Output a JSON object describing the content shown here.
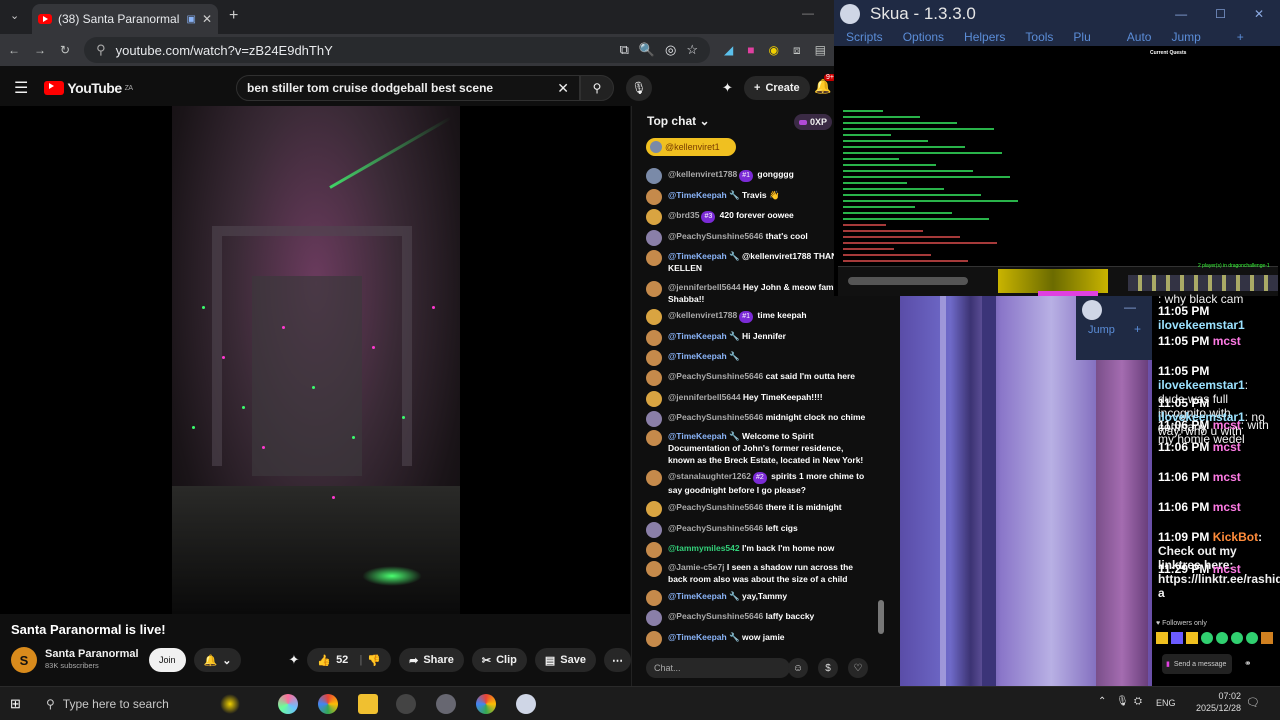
{
  "browser": {
    "tab_title": "(38) Santa Paranormal is live!",
    "url": "youtube.com/watch?v=zB24E9dhThY"
  },
  "youtube": {
    "logo": "YouTube",
    "region": "ZA",
    "search_value": "ben stiller tom cruise dodgeball best scene",
    "create_label": "Create",
    "notif_count": "9+"
  },
  "video": {
    "title": "Santa Paranormal is live!",
    "channel": "Santa Paranormal",
    "subscribers": "83K subscribers",
    "join_label": "Join",
    "likes": "52",
    "share_label": "Share",
    "clip_label": "Clip",
    "save_label": "Save"
  },
  "chat": {
    "header": "Top chat",
    "xp_label": "0XP",
    "pinned_user": "@kellenviret1",
    "messages": [
      {
        "user": "@kellenviret1788",
        "badge": "#1",
        "text": "gongggg",
        "role": "normal"
      },
      {
        "user": "@TimeKeepah",
        "badge": "",
        "text": "Travis 👋",
        "role": "mod"
      },
      {
        "user": "@brd35",
        "badge": "#3",
        "text": "420 forever oowee",
        "role": "normal"
      },
      {
        "user": "@PeachySunshine5646",
        "badge": "",
        "text": "that's cool",
        "role": "normal"
      },
      {
        "user": "@TimeKeepah",
        "badge": "",
        "text": "@kellenviret1788 THANK YOU KELLEN",
        "role": "mod"
      },
      {
        "user": "@jenniferbell5644",
        "badge": "",
        "text": "Hey John & meow fam! doing Shabba!!",
        "role": "normal"
      },
      {
        "user": "@kellenviret1788",
        "badge": "#1",
        "text": "time keepah",
        "role": "normal"
      },
      {
        "user": "@TimeKeepah",
        "badge": "",
        "text": "Hi Jennifer",
        "role": "mod"
      },
      {
        "user": "@TimeKeepah",
        "badge": "",
        "text": "",
        "role": "mod"
      },
      {
        "user": "@PeachySunshine5646",
        "badge": "",
        "text": "cat said I'm outta here",
        "role": "normal"
      },
      {
        "user": "@jenniferbell5644",
        "badge": "",
        "text": "Hey TimeKeepah!!!!",
        "role": "normal"
      },
      {
        "user": "@PeachySunshine5646",
        "badge": "",
        "text": "midnight clock no chime",
        "role": "normal"
      },
      {
        "user": "@TimeKeepah",
        "badge": "",
        "text": "Welcome to Spirit Documentation of John's former residence, known as the Breck Estate, located in New York!",
        "role": "mod"
      },
      {
        "user": "@stanalaughter1262",
        "badge": "#2",
        "text": "spirits 1 more chime to say goodnight before I go please?",
        "role": "normal"
      },
      {
        "user": "@PeachySunshine5646",
        "badge": "",
        "text": "there it is midnight",
        "role": "normal"
      },
      {
        "user": "@PeachySunshine5646",
        "badge": "",
        "text": "left cigs",
        "role": "normal"
      },
      {
        "user": "@tammymiles542",
        "badge": "",
        "text": "I'm back I'm home now",
        "role": "green"
      },
      {
        "user": "@Jamie-c5e7j",
        "badge": "",
        "text": "I seen a shadow run across the back room also was about the size of a child",
        "role": "normal"
      },
      {
        "user": "@TimeKeepah",
        "badge": "",
        "text": "yay,Tammy",
        "role": "mod"
      },
      {
        "user": "@PeachySunshine5646",
        "badge": "",
        "text": "laffy baccky",
        "role": "normal"
      },
      {
        "user": "@TimeKeepah",
        "badge": "",
        "text": "wow jamie",
        "role": "mod"
      }
    ],
    "input_placeholder": "Chat..."
  },
  "skua": {
    "title": "Skua - 1.3.3.0",
    "menu": [
      "Scripts",
      "Options",
      "Helpers",
      "Tools",
      "Plu",
      "Auto",
      "Jump"
    ],
    "quest_title": "Current Quests",
    "players": "2 player(s) in dragonchallenge-1"
  },
  "twitch": {
    "messages": [
      {
        "time": "",
        "user": "",
        "text": ": why black cam"
      },
      {
        "time": "11:05 PM",
        "user": "ilovekeemstar1",
        "text": ""
      },
      {
        "time": "11:05 PM",
        "user": "mcst",
        "text": ""
      },
      {
        "time": "11:05 PM",
        "user": "ilovekeemstar1",
        "text": ": dude was full incognito with company"
      },
      {
        "time": "11:05 PM",
        "user": "ilovekeemstar1",
        "text": ": no way. who u with"
      },
      {
        "time": "11:06 PM",
        "user": "mcst",
        "text": ": with my homie wedel"
      },
      {
        "time": "11:06 PM",
        "user": "mcst",
        "text": ""
      },
      {
        "time": "11:06 PM",
        "user": "mcst",
        "text": ""
      },
      {
        "time": "11:06 PM",
        "user": "mcst",
        "text": ""
      },
      {
        "time": "11:09 PM",
        "user": "KickBot",
        "text": ": Check out my linktree here: https://linktr.ee/rashidurgen a"
      },
      {
        "time": "11:29 PM",
        "user": "mcst",
        "text": ""
      }
    ],
    "followers_only": "Followers only",
    "send_label": "Send a message"
  },
  "taskbar": {
    "search_placeholder": "Type here to search",
    "lang": "ENG",
    "time": "07:02",
    "date": "2025/12/28"
  }
}
